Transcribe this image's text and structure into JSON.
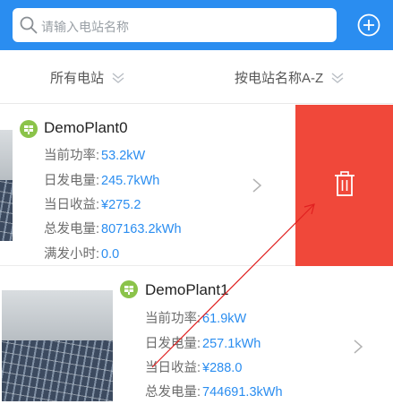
{
  "search": {
    "placeholder": "请输入电站名称"
  },
  "filters": {
    "all": "所有电站",
    "sort": "按电站名称A-Z"
  },
  "plants": [
    {
      "name": "DemoPlant0",
      "rows": [
        {
          "label": "当前功率:",
          "value": "53.2kW"
        },
        {
          "label": "日发电量:",
          "value": "245.7kWh"
        },
        {
          "label": "当日收益:",
          "value": "¥275.2"
        },
        {
          "label": "总发电量:",
          "value": "807163.2kWh"
        },
        {
          "label": "满发小时:",
          "value": "0.0"
        }
      ]
    },
    {
      "name": "DemoPlant1",
      "rows": [
        {
          "label": "当前功率:",
          "value": "61.9kW"
        },
        {
          "label": "日发电量:",
          "value": "257.1kWh"
        },
        {
          "label": "当日收益:",
          "value": "¥288.0"
        },
        {
          "label": "总发电量:",
          "value": "744691.3kWh"
        }
      ]
    }
  ],
  "colors": {
    "accent": "#2a8df0",
    "delete": "#f0483a",
    "annotation": "#e02020"
  },
  "icons": {
    "search": "search-icon",
    "add": "add-circle-icon",
    "delete": "trash-icon",
    "plant": "solar-plant-icon"
  }
}
